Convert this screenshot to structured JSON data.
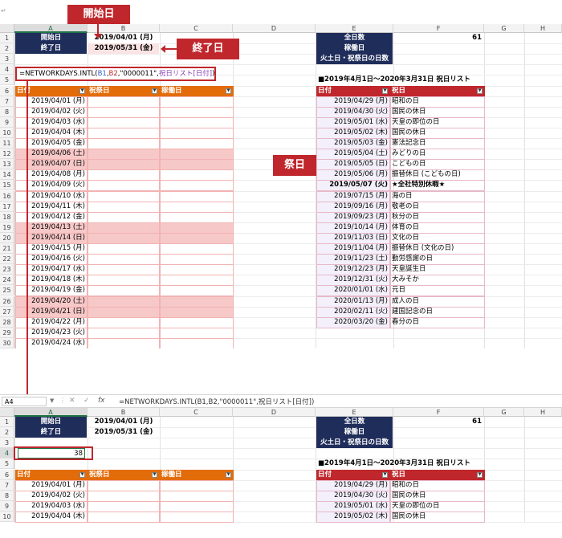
{
  "columns": [
    "A",
    "B",
    "C",
    "D",
    "E",
    "F",
    "G",
    "H"
  ],
  "rows_top": [
    "1",
    "2",
    "3",
    "4",
    "5",
    "6",
    "7",
    "8",
    "9",
    "10",
    "11",
    "12",
    "13",
    "14",
    "15",
    "16",
    "17",
    "18",
    "19",
    "20",
    "21",
    "22",
    "23",
    "24",
    "25",
    "26",
    "27",
    "28",
    "29",
    "30"
  ],
  "rows_bottom": [
    "1",
    "2",
    "3",
    "4",
    "5",
    "6",
    "7",
    "8",
    "9",
    "10"
  ],
  "labels": {
    "start": "開始日",
    "end": "終了日",
    "total": "全日数",
    "work": "稼働日",
    "holiday_days": "火土日・祝祭日の日数"
  },
  "values": {
    "start": "2019/04/01 (月)",
    "end": "2019/05/31 (金)",
    "total": "61",
    "result": "38"
  },
  "formula": "=NETWORKDAYS.INTL(B1,B2,\"0000011\",祝日リスト[日付])",
  "formula_parts": {
    "p1": "=NETWORKDAYS.INTL(",
    "p2": "B1",
    "p3": ",",
    "p4": "B2",
    "p5": ",\"0000011\",",
    "p6": "祝日リスト[日付]",
    "p7": ")"
  },
  "name_box": "A4",
  "fx": "fx",
  "callouts": {
    "start": "開始日",
    "end": "終了日",
    "holiday": "祭日"
  },
  "left_table": {
    "h1": "日付",
    "h2": "祝祭日",
    "h3": "稼働日"
  },
  "right_title": "■2019年4月1日〜2020年3月31日 祝日リスト",
  "right_table": {
    "h1": "日付",
    "h2": "祝日"
  },
  "dates": [
    "2019/04/01 (月)",
    "2019/04/02 (火)",
    "2019/04/03 (水)",
    "2019/04/04 (木)",
    "2019/04/05 (金)",
    "2019/04/06 (土)",
    "2019/04/07 (日)",
    "2019/04/08 (月)",
    "2019/04/09 (火)",
    "2019/04/10 (水)",
    "2019/04/11 (木)",
    "2019/04/12 (金)",
    "2019/04/13 (土)",
    "2019/04/14 (日)",
    "2019/04/15 (月)",
    "2019/04/16 (火)",
    "2019/04/17 (水)",
    "2019/04/18 (木)",
    "2019/04/19 (金)",
    "2019/04/20 (土)",
    "2019/04/21 (日)",
    "2019/04/22 (月)",
    "2019/04/23 (火)",
    "2019/04/24 (水)"
  ],
  "weekend_rows": [
    5,
    6,
    12,
    13,
    19,
    20
  ],
  "holidays": [
    {
      "date": "2019/04/29 (月)",
      "name": "昭和の日"
    },
    {
      "date": "2019/04/30 (火)",
      "name": "国民の休日"
    },
    {
      "date": "2019/05/01 (水)",
      "name": "天皇の即位の日"
    },
    {
      "date": "2019/05/02 (木)",
      "name": "国民の休日"
    },
    {
      "date": "2019/05/03 (金)",
      "name": "憲法記念日"
    },
    {
      "date": "2019/05/04 (土)",
      "name": "みどりの日"
    },
    {
      "date": "2019/05/05 (日)",
      "name": "こどもの日"
    },
    {
      "date": "2019/05/06 (月)",
      "name": "振替休日 (こどもの日)"
    },
    {
      "date": "2019/05/07 (火)",
      "name": "★全社特別休暇★"
    },
    {
      "date": "2019/07/15 (月)",
      "name": "海の日"
    },
    {
      "date": "2019/09/16 (月)",
      "name": "敬老の日"
    },
    {
      "date": "2019/09/23 (月)",
      "name": "秋分の日"
    },
    {
      "date": "2019/10/14 (月)",
      "name": "体育の日"
    },
    {
      "date": "2019/11/03 (日)",
      "name": "文化の日"
    },
    {
      "date": "2019/11/04 (月)",
      "name": "振替休日 (文化の日)"
    },
    {
      "date": "2019/11/23 (土)",
      "name": "勤労感謝の日"
    },
    {
      "date": "2019/12/23 (月)",
      "name": "天皇誕生日"
    },
    {
      "date": "2019/12/31 (火)",
      "name": "大みそか"
    },
    {
      "date": "2020/01/01 (水)",
      "name": "元日"
    },
    {
      "date": "2020/01/13 (月)",
      "name": "成人の日"
    },
    {
      "date": "2020/02/11 (火)",
      "name": "建国記念の日"
    },
    {
      "date": "2020/03/20 (金)",
      "name": "春分の日"
    }
  ],
  "colors": {
    "navy": "#1f2d5b",
    "orange": "#e36c0a",
    "red": "#c0272d",
    "weekend": "#f7c8c8"
  }
}
